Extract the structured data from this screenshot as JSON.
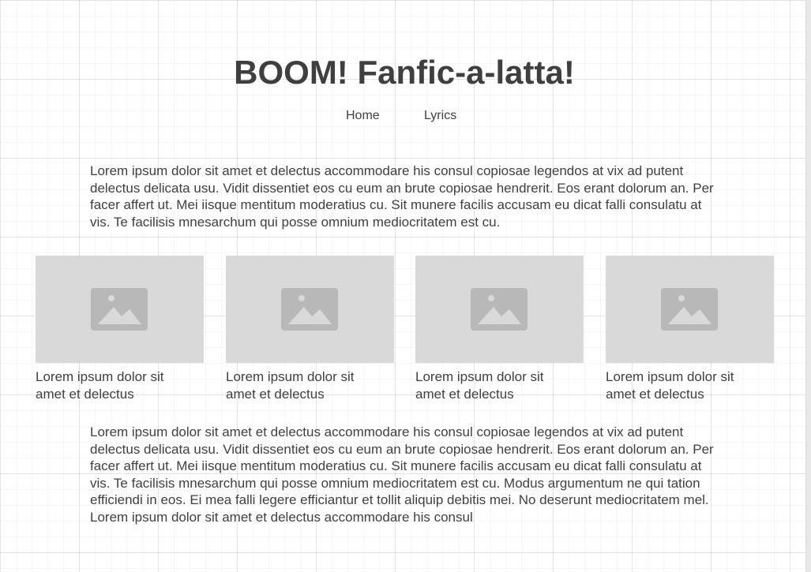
{
  "site": {
    "title": "BOOM! Fanfic-a-latta!"
  },
  "nav": {
    "items": [
      {
        "label": "Home"
      },
      {
        "label": "Lyrics"
      }
    ]
  },
  "intro": {
    "text": "Lorem ipsum dolor sit amet et delectus accommodare his consul copiosae legendos at vix ad putent delectus delicata usu. Vidit dissentiet eos cu eum an brute copiosae hendrerit. Eos erant dolorum an. Per facer affert ut. Mei iisque mentitum moderatius cu. Sit munere facilis accusam eu dicat falli consulatu at vis. Te facilisis mnesarchum qui posse omnium mediocritatem est cu."
  },
  "cards": [
    {
      "image_icon": "image-placeholder-icon",
      "caption": "Lorem ipsum dolor sit amet et delectus"
    },
    {
      "image_icon": "image-placeholder-icon",
      "caption": "Lorem ipsum dolor sit amet et delectus"
    },
    {
      "image_icon": "image-placeholder-icon",
      "caption": "Lorem ipsum dolor sit amet et delectus"
    },
    {
      "image_icon": "image-placeholder-icon",
      "caption": "Lorem ipsum dolor sit amet et delectus"
    }
  ],
  "body": {
    "text": "Lorem ipsum dolor sit amet et delectus accommodare his consul copiosae legendos at vix ad putent delectus delicata usu. Vidit dissentiet eos cu eum an brute copiosae hendrerit. Eos erant dolorum an. Per facer affert ut. Mei iisque mentitum moderatius cu. Sit munere facilis accusam eu dicat falli consulatu at vis. Te facilisis mnesarchum qui posse omnium mediocritatem est cu. Modus argumentum ne qui tation efficiendi in eos. Ei mea falli legere efficiantur et tollit aliquip debitis mei. No deserunt mediocritatem mel. Lorem ipsum dolor sit amet et delectus accommodare his consul"
  },
  "colors": {
    "text": "#404040",
    "placeholder_bg": "#d9d9d9",
    "placeholder_icon": "#b8b8b8"
  }
}
